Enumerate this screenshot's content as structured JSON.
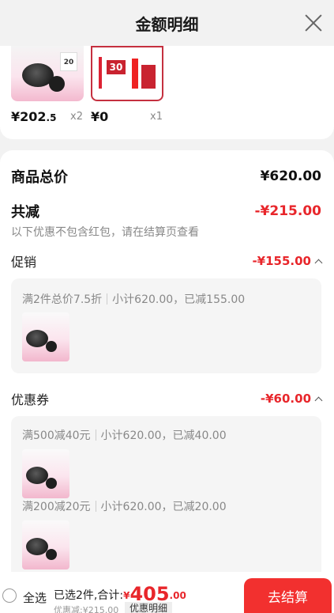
{
  "header": {
    "title": "金额明细"
  },
  "products": [
    {
      "price_main": "¥202",
      "price_dec": ".5",
      "qty": "x2",
      "badge": "20"
    },
    {
      "price_main": "¥0",
      "price_dec": "",
      "qty": "x1",
      "badge": "30"
    }
  ],
  "summary": {
    "total_label": "商品总价",
    "total_value": "¥620.00",
    "reduce_label": "共减",
    "reduce_value": "-¥215.00",
    "note": "以下优惠不包含红包，请在结算页查看"
  },
  "promotion": {
    "label": "促销",
    "value": "-¥155.00",
    "rule_name": "满2件总价7.5折",
    "rule_detail": "小计620.00，已减155.00"
  },
  "coupon": {
    "label": "优惠券",
    "value": "-¥60.00",
    "rules": [
      {
        "name": "满500减40元",
        "detail": "小计620.00，已减40.00"
      },
      {
        "name": "满200减20元",
        "detail": "小计620.00，已减20.00"
      }
    ]
  },
  "bottom_bar": {
    "select_all": "全选",
    "selected_text": "已选2件,合计:",
    "currency": "¥",
    "amount_int": "405",
    "amount_dec": ".00",
    "discount_text": "优惠减:¥215.00",
    "discount_btn": "优惠明细",
    "checkout": "去结算"
  },
  "colors": {
    "accent": "#e8262b",
    "checkout_bg": "#f2302f"
  }
}
